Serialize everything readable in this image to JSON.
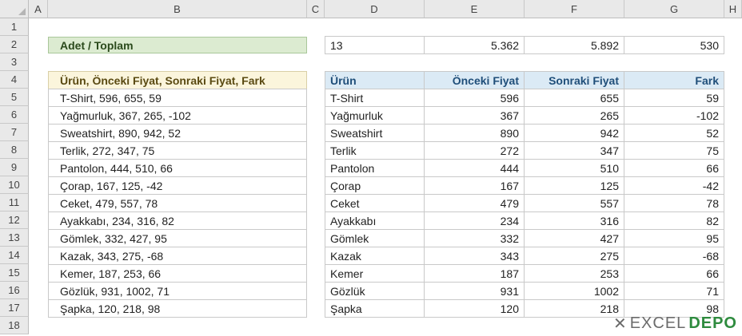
{
  "columns": [
    "A",
    "B",
    "C",
    "D",
    "E",
    "F",
    "G",
    "H"
  ],
  "rows": [
    "1",
    "2",
    "3",
    "4",
    "5",
    "6",
    "7",
    "8",
    "9",
    "10",
    "11",
    "12",
    "13",
    "14",
    "15",
    "16",
    "17",
    "18"
  ],
  "summary": {
    "label": "Adet / Toplam",
    "count": "13",
    "total_prev": "5.362",
    "total_next": "5.892",
    "total_diff": "530"
  },
  "source_header": "Ürün, Önceki Fiyat, Sonraki Fiyat, Fark",
  "source_rows": [
    "T-Shirt, 596, 655, 59",
    "Yağmurluk, 367, 265, -102",
    "Sweatshirt, 890, 942, 52",
    "Terlik, 272, 347, 75",
    "Pantolon, 444, 510, 66",
    "Çorap, 167, 125, -42",
    "Ceket, 479, 557, 78",
    "Ayakkabı, 234, 316, 82",
    "Gömlek, 332, 427, 95",
    "Kazak, 343, 275, -68",
    "Kemer, 187, 253, 66",
    "Gözlük, 931, 1002, 71",
    "Şapka, 120, 218, 98"
  ],
  "table_headers": [
    "Ürün",
    "Önceki Fiyat",
    "Sonraki Fiyat",
    "Fark"
  ],
  "table_rows": [
    [
      "T-Shirt",
      "596",
      "655",
      "59"
    ],
    [
      "Yağmurluk",
      "367",
      "265",
      "-102"
    ],
    [
      "Sweatshirt",
      "890",
      "942",
      "52"
    ],
    [
      "Terlik",
      "272",
      "347",
      "75"
    ],
    [
      "Pantolon",
      "444",
      "510",
      "66"
    ],
    [
      "Çorap",
      "167",
      "125",
      "-42"
    ],
    [
      "Ceket",
      "479",
      "557",
      "78"
    ],
    [
      "Ayakkabı",
      "234",
      "316",
      "82"
    ],
    [
      "Gömlek",
      "332",
      "427",
      "95"
    ],
    [
      "Kazak",
      "343",
      "275",
      "-68"
    ],
    [
      "Kemer",
      "187",
      "253",
      "66"
    ],
    [
      "Gözlük",
      "931",
      "1002",
      "71"
    ],
    [
      "Şapka",
      "120",
      "218",
      "98"
    ]
  ],
  "watermark": {
    "part1": "EXCEL",
    "part2": "DEPO"
  }
}
